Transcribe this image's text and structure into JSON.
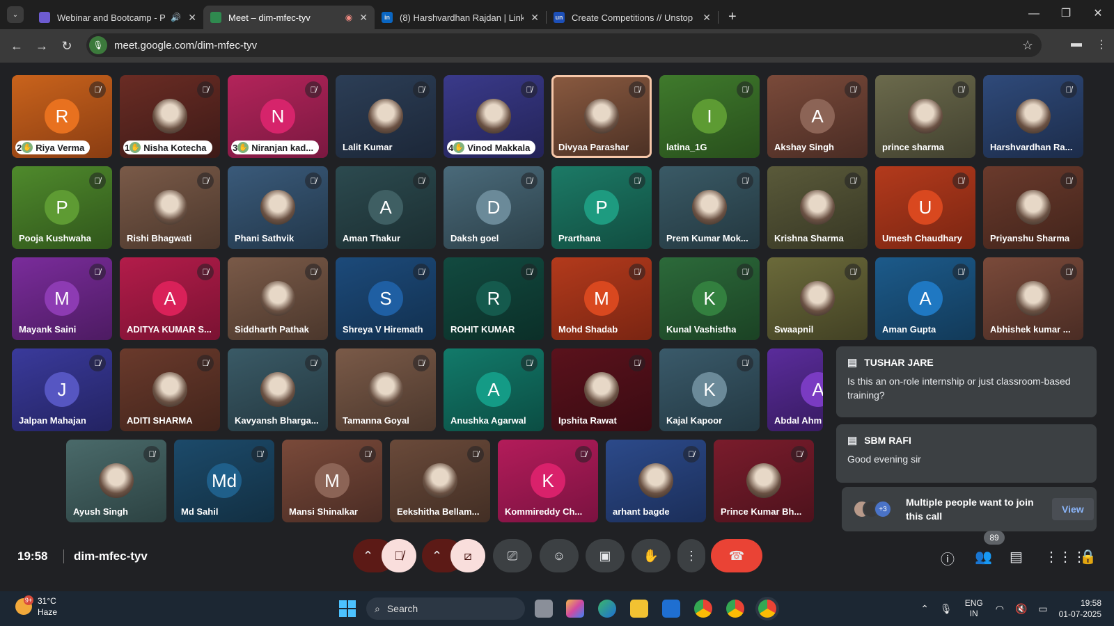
{
  "browser": {
    "tabs": [
      {
        "title": "Webinar and Bootcamp - P",
        "extra": "🔊",
        "fav": "#6d5bd0",
        "favtext": "",
        "active": false
      },
      {
        "title": "Meet – dim-mfec-tyv",
        "extra": "◉",
        "fav": "#2f8a4f",
        "favtext": "",
        "active": true
      },
      {
        "title": "(8) Harshvardhan Rajdan | Linke",
        "extra": "",
        "fav": "#0a66c2",
        "favtext": "in",
        "active": false
      },
      {
        "title": "Create Competitions // Unstop",
        "extra": "",
        "fav": "#1c4fb8",
        "favtext": "un",
        "active": false
      }
    ],
    "url": "meet.google.com/dim-mfec-tyv"
  },
  "tiles": [
    {
      "name": "Riya Verma",
      "initial": "R",
      "bg": "linear-gradient(160deg,#c9631c,#8a3d12)",
      "av": "#e8711f",
      "pill": "2"
    },
    {
      "name": "Nisha Kotecha",
      "initial": "",
      "bg": "linear-gradient(160deg,#6a2c24,#3d1a17)",
      "av": "",
      "pill": "1"
    },
    {
      "name": "Niranjan kad...",
      "initial": "N",
      "bg": "linear-gradient(160deg,#b3245a,#7a1840)",
      "av": "#d6246b",
      "pill": "3"
    },
    {
      "name": "Lalit Kumar",
      "initial": "",
      "bg": "linear-gradient(160deg,#2c3e56,#1c2738)",
      "av": "",
      "pill": ""
    },
    {
      "name": "Vinod Makkala",
      "initial": "",
      "bg": "linear-gradient(160deg,#3a3a8a,#232357)",
      "av": "",
      "pill": "4"
    },
    {
      "name": "Divyaa Parashar",
      "initial": "",
      "bg": "linear-gradient(160deg,#8a5a40,#4b3024)",
      "av": "",
      "pill": "",
      "speaking": true
    },
    {
      "name": "latina_1G",
      "initial": "I",
      "bg": "linear-gradient(160deg,#3f7a2c,#284f1c)",
      "av": "#5d9b33",
      "pill": ""
    },
    {
      "name": "Akshay Singh",
      "initial": "A",
      "bg": "linear-gradient(160deg,#7a4a3a,#4a2c24)",
      "av": "#8c6456",
      "pill": ""
    },
    {
      "name": "prince sharma",
      "initial": "",
      "bg": "linear-gradient(160deg,#6b6a4c,#42412f)",
      "av": "",
      "pill": ""
    },
    {
      "name": "Harshvardhan Ra...",
      "initial": "",
      "bg": "linear-gradient(160deg,#2f4a7a,#1c2c4a)",
      "av": "",
      "pill": ""
    },
    {
      "name": "Pooja Kushwaha",
      "initial": "P",
      "bg": "linear-gradient(160deg,#4f8a2c,#30561b)",
      "av": "#5e9b33",
      "pill": ""
    },
    {
      "name": "Rishi Bhagwati",
      "initial": "",
      "bg": "linear-gradient(160deg,#7a5a48,#4b372c)",
      "av": "",
      "pill": ""
    },
    {
      "name": "Phani Sathvik",
      "initial": "",
      "bg": "linear-gradient(160deg,#3a5a7a,#22374a)",
      "av": "",
      "pill": ""
    },
    {
      "name": "Aman Thakur",
      "initial": "A",
      "bg": "linear-gradient(160deg,#2c4a4f,#1b2e31)",
      "av": "#3f5f63",
      "pill": ""
    },
    {
      "name": "Daksh goel",
      "initial": "D",
      "bg": "linear-gradient(160deg,#4a6a7a,#2c4049)",
      "av": "#6b8a99",
      "pill": ""
    },
    {
      "name": "Prarthana",
      "initial": "P",
      "bg": "linear-gradient(160deg,#1c7a66,#114d40)",
      "av": "#1e9b80",
      "pill": ""
    },
    {
      "name": "Prem Kumar Mok...",
      "initial": "",
      "bg": "linear-gradient(160deg,#3a5a66,#23373f)",
      "av": "",
      "pill": ""
    },
    {
      "name": "Krishna Sharma",
      "initial": "",
      "bg": "linear-gradient(160deg,#5a5a3a,#373724)",
      "av": "",
      "pill": ""
    },
    {
      "name": "Umesh Chaudhary",
      "initial": "U",
      "bg": "linear-gradient(160deg,#b33a1c,#7a2512)",
      "av": "#d9481f",
      "pill": ""
    },
    {
      "name": "Priyanshu Sharma",
      "initial": "",
      "bg": "linear-gradient(160deg,#6a3a2c,#42241b)",
      "av": "",
      "pill": ""
    },
    {
      "name": "Mayank Saini",
      "initial": "M",
      "bg": "linear-gradient(160deg,#7a2c9b,#4d1b62)",
      "av": "#8d3bb3",
      "pill": ""
    },
    {
      "name": "ADITYA KUMAR S...",
      "initial": "A",
      "bg": "linear-gradient(160deg,#b31c4a,#7a1232)",
      "av": "#d92159",
      "pill": ""
    },
    {
      "name": "Siddharth Pathak",
      "initial": "",
      "bg": "linear-gradient(160deg,#7a5a48,#4b372c)",
      "av": "",
      "pill": ""
    },
    {
      "name": "Shreya V Hiremath",
      "initial": "S",
      "bg": "linear-gradient(160deg,#1c4a7a,#12304f)",
      "av": "#1f5fa3",
      "pill": ""
    },
    {
      "name": "ROHIT KUMAR",
      "initial": "R",
      "bg": "linear-gradient(160deg,#124a40,#0b2f28)",
      "av": "#155a4d",
      "pill": ""
    },
    {
      "name": "Mohd Shadab",
      "initial": "M",
      "bg": "linear-gradient(160deg,#b33a1c,#7a2512)",
      "av": "#d9481f",
      "pill": ""
    },
    {
      "name": "Kunal Vashistha",
      "initial": "K",
      "bg": "linear-gradient(160deg,#2c6a3a,#1b4224)",
      "av": "#33803f",
      "pill": ""
    },
    {
      "name": "Swaapnil",
      "initial": "",
      "bg": "linear-gradient(160deg,#6b6a3a,#424124)",
      "av": "",
      "pill": ""
    },
    {
      "name": "Aman Gupta",
      "initial": "A",
      "bg": "linear-gradient(160deg,#1c5a8a,#123a59)",
      "av": "#1f78c2",
      "pill": ""
    },
    {
      "name": "Abhishek kumar ...",
      "initial": "",
      "bg": "linear-gradient(160deg,#7a4a3a,#4a2c24)",
      "av": "",
      "pill": ""
    },
    {
      "name": "Jalpan Mahajan",
      "initial": "J",
      "bg": "linear-gradient(160deg,#3a3a9b,#232362)",
      "av": "#5656c2",
      "pill": ""
    },
    {
      "name": "ADITI SHARMA",
      "initial": "",
      "bg": "linear-gradient(160deg,#6a3a2c,#42241b)",
      "av": "",
      "pill": ""
    },
    {
      "name": "Kavyansh Bharga...",
      "initial": "",
      "bg": "linear-gradient(160deg,#3a5a66,#23373f)",
      "av": "",
      "pill": ""
    },
    {
      "name": "Tamanna Goyal",
      "initial": "",
      "bg": "linear-gradient(160deg,#7a5a48,#4b372c)",
      "av": "",
      "pill": ""
    },
    {
      "name": "Anushka Agarwal",
      "initial": "A",
      "bg": "linear-gradient(160deg,#127a6a,#0b4d43)",
      "av": "#149b86",
      "pill": ""
    },
    {
      "name": "Ipshita Rawat",
      "initial": "",
      "bg": "linear-gradient(160deg,#5a121c,#3a0b12)",
      "av": "",
      "pill": ""
    },
    {
      "name": "Kajal Kapoor",
      "initial": "K",
      "bg": "linear-gradient(160deg,#3a5a6a,#233842)",
      "av": "#6b8a99",
      "pill": ""
    },
    {
      "name": "Abdal Ahm",
      "initial": "A",
      "bg": "linear-gradient(160deg,#5a2c9b,#381b62)",
      "av": "#7a3bc2",
      "pill": ""
    },
    {
      "name": "Ayush Singh",
      "initial": "",
      "bg": "linear-gradient(160deg,#4a6a6a,#2c4242)",
      "av": "",
      "pill": ""
    },
    {
      "name": "Md Sahil",
      "initial": "Md",
      "bg": "linear-gradient(160deg,#1c4a6a,#122f42)",
      "av": "#1f5f8a",
      "pill": ""
    },
    {
      "name": "Mansi Shinalkar",
      "initial": "M",
      "bg": "linear-gradient(160deg,#7a4a3a,#4a2c24)",
      "av": "#8c6456",
      "pill": ""
    },
    {
      "name": "Eekshitha Bellam...",
      "initial": "",
      "bg": "linear-gradient(160deg,#6a4a3a,#422e24)",
      "av": "",
      "pill": ""
    },
    {
      "name": "Kommireddy Ch...",
      "initial": "K",
      "bg": "linear-gradient(160deg,#b31c5a,#7a1240)",
      "av": "#d9216b",
      "pill": ""
    },
    {
      "name": "arhant bagde",
      "initial": "",
      "bg": "linear-gradient(160deg,#2c4a8a,#1b2e59)",
      "av": "",
      "pill": ""
    },
    {
      "name": "Prince Kumar Bh...",
      "initial": "",
      "bg": "linear-gradient(160deg,#7a1c2c,#4d121c)",
      "av": "",
      "pill": ""
    }
  ],
  "chat": [
    {
      "author": "TUSHAR JARE",
      "message": "Is this an on-role internship or just classroom-based training?"
    },
    {
      "author": "SBM RAFI",
      "message": "Good evening sir"
    }
  ],
  "join_request": {
    "count": "+3",
    "text": "Multiple people want to join this call",
    "view_label": "View"
  },
  "meeting": {
    "time": "19:58",
    "code": "dim-mfec-tyv",
    "participants": "89"
  },
  "taskbar": {
    "temp": "31°C",
    "condition": "Haze",
    "weather_badge": "9+",
    "search": "Search",
    "lang1": "ENG",
    "lang2": "IN",
    "time": "19:58",
    "date": "01-07-2025"
  },
  "colors": {
    "end_call": "#ea4335",
    "mic_off": "#f9dedc",
    "surface": "#3c4043"
  }
}
